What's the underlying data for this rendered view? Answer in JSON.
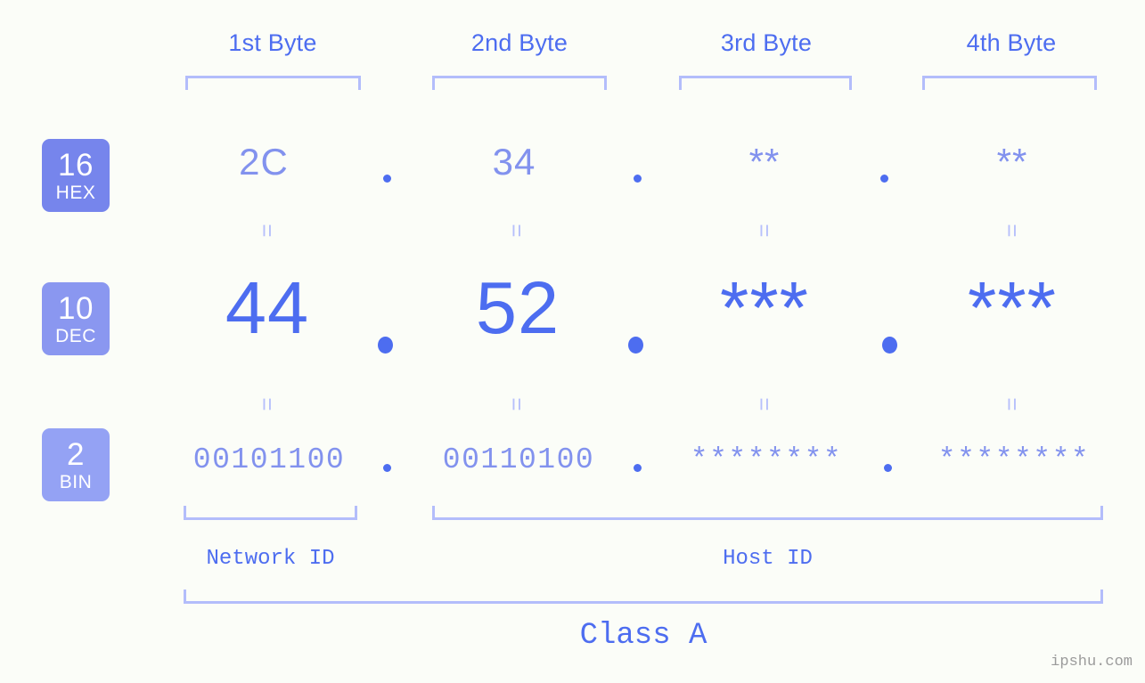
{
  "meta": {
    "background_color": "#fbfdf8",
    "accent_color": "#4d6df0",
    "accent_light_color": "#8292ee",
    "bracket_color": "#b3bdfb",
    "watermark": "ipshu.com"
  },
  "byte_headers": [
    {
      "label": "1st Byte"
    },
    {
      "label": "2nd Byte"
    },
    {
      "label": "3rd Byte"
    },
    {
      "label": "4th Byte"
    }
  ],
  "bases": [
    {
      "number": "16",
      "abbr": "HEX",
      "badge_color": "#7685ec"
    },
    {
      "number": "10",
      "abbr": "DEC",
      "badge_color": "#8a97f0"
    },
    {
      "number": "2",
      "abbr": "BIN",
      "badge_color": "#94a2f4"
    }
  ],
  "rows": {
    "hex": {
      "values": [
        "2C",
        "34",
        "**",
        "**"
      ]
    },
    "dec": {
      "values": [
        "44",
        "52",
        "***",
        "***"
      ]
    },
    "bin": {
      "values": [
        "00101100",
        "00110100",
        "********",
        "********"
      ]
    }
  },
  "separators": {
    "dot": "."
  },
  "equals_mark": "=",
  "regions": [
    {
      "label": "Network ID"
    },
    {
      "label": "Host ID"
    }
  ],
  "class": {
    "label": "Class A"
  }
}
